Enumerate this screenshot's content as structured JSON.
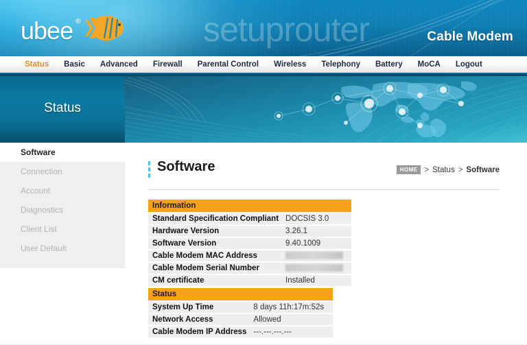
{
  "header": {
    "brand_name": "ubee",
    "brand_registered": "®",
    "brand_fish_icon": "angelfish-logo-icon",
    "watermark": "setuprouter",
    "device_type": "Cable Modem"
  },
  "nav": {
    "items": [
      {
        "label": "Status",
        "active": true
      },
      {
        "label": "Basic",
        "active": false
      },
      {
        "label": "Advanced",
        "active": false
      },
      {
        "label": "Firewall",
        "active": false
      },
      {
        "label": "Parental Control",
        "active": false
      },
      {
        "label": "Wireless",
        "active": false
      },
      {
        "label": "Telephony",
        "active": false
      },
      {
        "label": "Battery",
        "active": false
      },
      {
        "label": "MoCA",
        "active": false
      },
      {
        "label": "Logout",
        "active": false
      }
    ]
  },
  "hero": {
    "panel_title": "Status",
    "banner_icon": "world-map-network-banner"
  },
  "sidebar": {
    "items": [
      {
        "label": "Software",
        "active": true
      },
      {
        "label": "Connection",
        "active": false
      },
      {
        "label": "Account",
        "active": false
      },
      {
        "label": "Diagnostics",
        "active": false
      },
      {
        "label": "Client List",
        "active": false
      },
      {
        "label": "User Default",
        "active": false
      }
    ]
  },
  "page": {
    "title": "Software",
    "breadcrumb": {
      "home_label": "HOME",
      "sep": ">",
      "trail": [
        "Status",
        "Software"
      ]
    }
  },
  "information_table": {
    "heading": "Information",
    "rows": [
      {
        "label": "Standard Specification Compliant",
        "value": "DOCSIS 3.0",
        "redacted": false
      },
      {
        "label": "Hardware Version",
        "value": "3.26.1",
        "redacted": false
      },
      {
        "label": "Software Version",
        "value": "9.40.1009",
        "redacted": false
      },
      {
        "label": "Cable Modem MAC Address",
        "value": "",
        "redacted": true
      },
      {
        "label": "Cable Modem Serial Number",
        "value": "",
        "redacted": true
      },
      {
        "label": "CM certificate",
        "value": "Installed",
        "redacted": false
      }
    ]
  },
  "status_table": {
    "heading": "Status",
    "rows": [
      {
        "label": "System Up Time",
        "value": "8 days 11h:17m:52s",
        "redacted": false
      },
      {
        "label": "Network Access",
        "value": "Allowed",
        "redacted": false
      },
      {
        "label": "Cable Modem IP Address",
        "value": "---.---.---.---",
        "redacted": false
      }
    ]
  },
  "colors": {
    "accent_orange": "#f5a21a",
    "nav_active": "#e8920c",
    "header_blue": "#0d85bd",
    "panel_blue": "#0b7ba3",
    "row_bg": "#eeeeee"
  }
}
